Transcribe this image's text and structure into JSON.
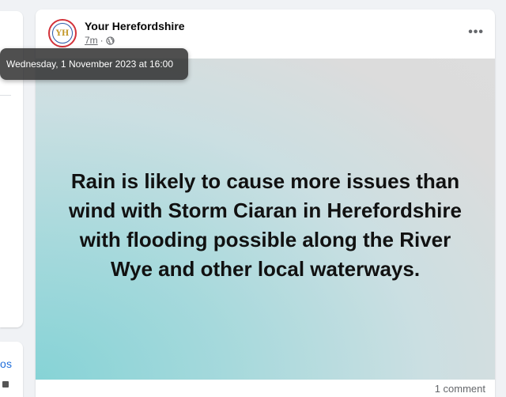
{
  "post": {
    "page_name": "Your Herefordshire",
    "avatar_text": "YH",
    "time": "7m",
    "separator": "·",
    "more_label": "•••",
    "headline": "Rain is likely to cause more issues than wind with Storm Ciaran in Herefordshire with flooding possible along the River Wye and other local waterways.",
    "comment_count": "1 comment"
  },
  "tooltip": {
    "text": "Wednesday, 1 November 2023 at 16:00"
  },
  "sidebar": {
    "link_text": "os"
  },
  "icons": {
    "privacy": "globe-icon",
    "more": "more-options-icon"
  },
  "colors": {
    "avatar_ring": "#d3323a",
    "link": "#216fdb",
    "image_teal": "#86d3d6",
    "image_grey": "#dddddd"
  }
}
